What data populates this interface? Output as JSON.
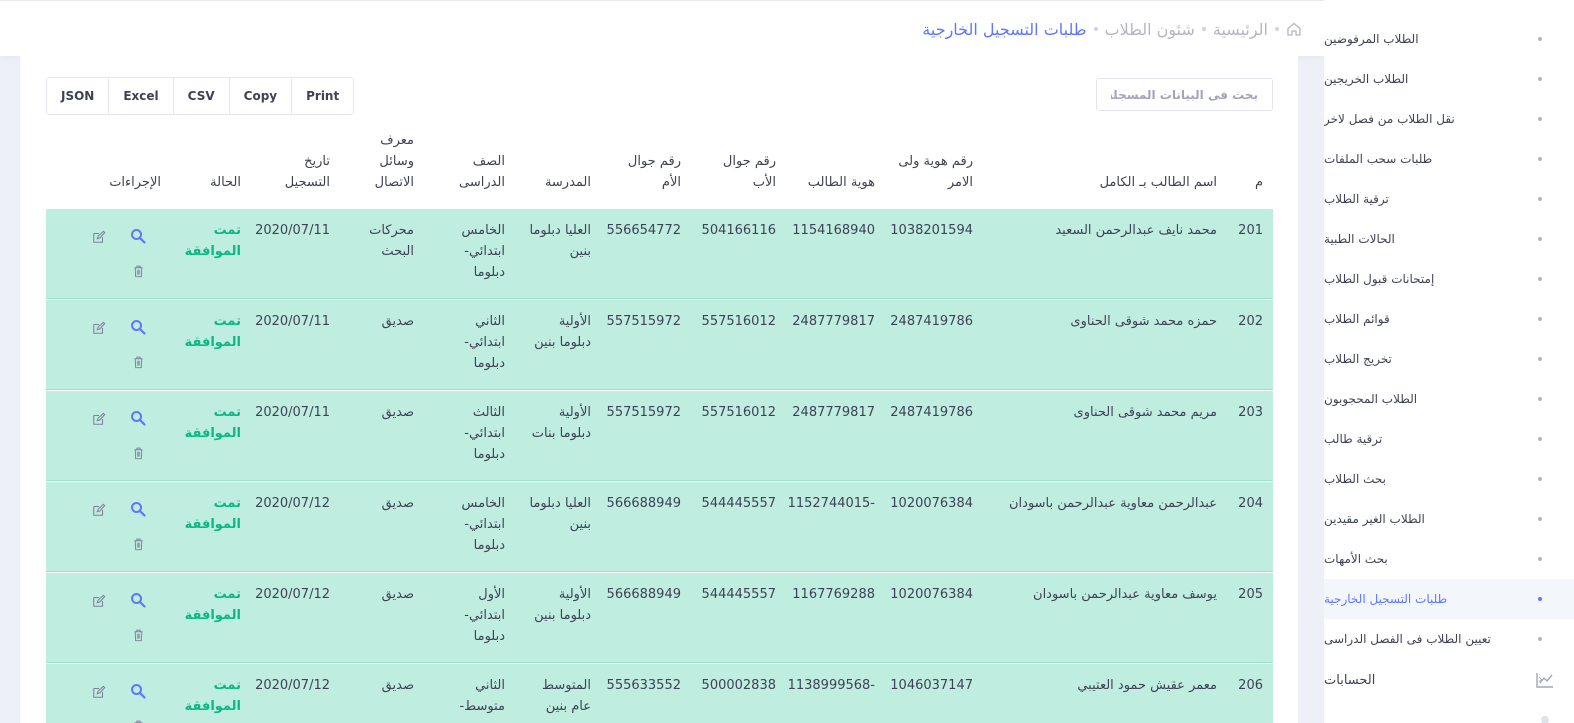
{
  "breadcrumb": {
    "home": "الرئيسية",
    "section": "شئون الطلاب",
    "current": "طلبات التسجيل الخارجية"
  },
  "sidebar": {
    "items": [
      {
        "label": "الطلاب المرفوضين"
      },
      {
        "label": "الطلاب الخريجين"
      },
      {
        "label": "نقل الطلاب من فصل لاخر"
      },
      {
        "label": "طلبات سحب الملفات"
      },
      {
        "label": "ترقية الطلاب"
      },
      {
        "label": "الحالات الطبية"
      },
      {
        "label": "إمتحانات قبول الطلاب"
      },
      {
        "label": "قوائم الطلاب"
      },
      {
        "label": "تخريج الطلاب"
      },
      {
        "label": "الطلاب المحجوبون"
      },
      {
        "label": "ترقية طالب"
      },
      {
        "label": "بحث الطلاب"
      },
      {
        "label": "الطلاب الغير مقيدين"
      },
      {
        "label": "بحث الأمهات"
      },
      {
        "label": "طلبات التسجيل الخارجية"
      },
      {
        "label": "تعيين الطلاب فى الفصل الدراسى"
      }
    ],
    "section_accounts": "الحسابات"
  },
  "toolbar": {
    "search_placeholder": "بحث فى البيانات المسجلة",
    "buttons": [
      "Print",
      "Copy",
      "CSV",
      "Excel",
      "JSON"
    ]
  },
  "table": {
    "headers": {
      "idx": "م",
      "name": "اسم الطالب بـ الكامل",
      "guardian_id": "رقم هوية ولى الامر",
      "student_id": "هوية الطالب",
      "father_mobile": "رقم جوال الأب",
      "mother_mobile": "رقم جوال الأم",
      "school": "المدرسة",
      "grade": "الصف الدراسى",
      "contact_source": "معرف وسائل الاتصال",
      "reg_date": "تاريخ التسجيل",
      "status": "الحالة",
      "actions": "الإجراءات"
    },
    "rows": [
      {
        "idx": "201",
        "name": "محمد نايف عبدالرحمن السعيد",
        "guardian_id": "1038201594",
        "student_id": "1154168940",
        "father_mobile": "504166116",
        "mother_mobile": "556654772",
        "school": "العليا دبلوما بنين",
        "grade": "الخامس ابتدائي- دبلوما",
        "contact_source": "محركات البحث",
        "reg_date": "2020/07/11",
        "status": "تمت الموافقة"
      },
      {
        "idx": "202",
        "name": "حمزه محمد شوقى الحناوى",
        "guardian_id": "2487419786",
        "student_id": "2487779817",
        "father_mobile": "557516012",
        "mother_mobile": "557515972",
        "school": "الأولية دبلوما بنين",
        "grade": "الثاني ابتدائي- دبلوما",
        "contact_source": "صديق",
        "reg_date": "2020/07/11",
        "status": "تمت الموافقة"
      },
      {
        "idx": "203",
        "name": "مريم محمد شوقى الحناوى",
        "guardian_id": "2487419786",
        "student_id": "2487779817",
        "father_mobile": "557516012",
        "mother_mobile": "557515972",
        "school": "الأولية دبلوما بنات",
        "grade": "الثالث ابتدائي- دبلوما",
        "contact_source": "صديق",
        "reg_date": "2020/07/11",
        "status": "تمت الموافقة"
      },
      {
        "idx": "204",
        "name": "عبدالرحمن معاوية عبدالرحمن باسودان",
        "guardian_id": "1020076384",
        "student_id": "1152744015-",
        "father_mobile": "544445557",
        "mother_mobile": "566688949",
        "school": "العليا دبلوما بنين",
        "grade": "الخامس ابتدائي- دبلوما",
        "contact_source": "صديق",
        "reg_date": "2020/07/12",
        "status": "تمت الموافقة"
      },
      {
        "idx": "205",
        "name": "يوسف معاوية عبدالرحمن باسودان",
        "guardian_id": "1020076384",
        "student_id": "1167769288",
        "father_mobile": "544445557",
        "mother_mobile": "566688949",
        "school": "الأولية دبلوما بنين",
        "grade": "الأول ابتدائي- دبلوما",
        "contact_source": "صديق",
        "reg_date": "2020/07/12",
        "status": "تمت الموافقة"
      },
      {
        "idx": "206",
        "name": "معمر عقيش حمود العتيبي",
        "guardian_id": "1046037147",
        "student_id": "1138999568-",
        "father_mobile": "500002838",
        "mother_mobile": "555633552",
        "school": "المتوسط عام بنين",
        "grade": "الثاني متوسط-",
        "contact_source": "صديق",
        "reg_date": "2020/07/12",
        "status": "تمت الموافقة"
      }
    ]
  },
  "colors": {
    "accent": "#5d78ff",
    "row_bg": "#bfeee0",
    "status_green": "#0bb783"
  },
  "icons": [
    "home-icon",
    "search-icon",
    "edit-icon",
    "trash-icon",
    "chart-icon",
    "chevron-icon"
  ]
}
